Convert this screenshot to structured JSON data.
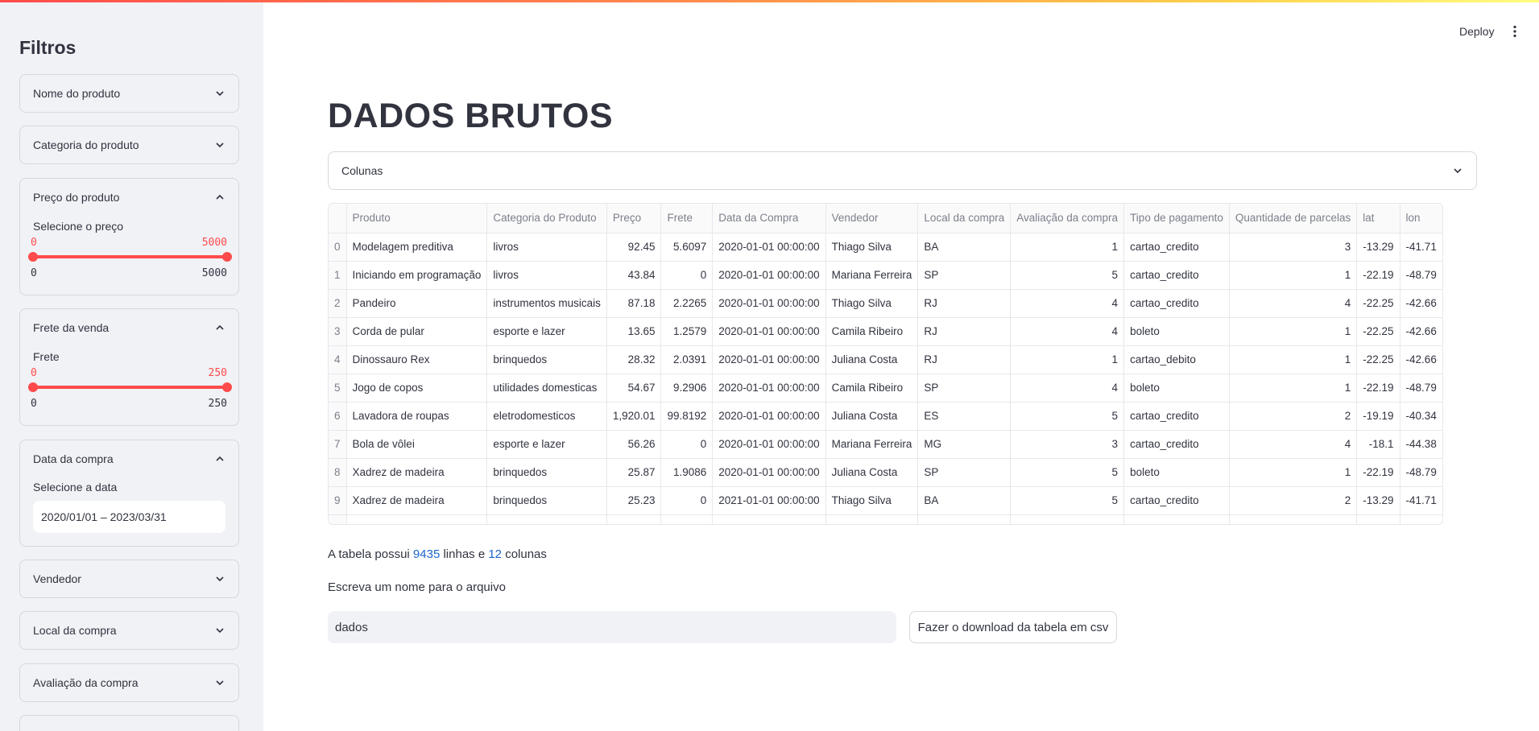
{
  "header": {
    "deploy_label": "Deploy",
    "menu_icon": "kebab-icon"
  },
  "sidebar": {
    "title": "Filtros",
    "nome_produto": {
      "label": "Nome do produto"
    },
    "categoria": {
      "label": "Categoria do produto"
    },
    "preco": {
      "label": "Preço do produto",
      "slider_label": "Selecione o preço",
      "low": "0",
      "high": "5000",
      "min": "0",
      "max": "5000"
    },
    "frete": {
      "label": "Frete da venda",
      "slider_label": "Frete",
      "low": "0",
      "high": "250",
      "min": "0",
      "max": "250"
    },
    "data": {
      "label": "Data da compra",
      "input_label": "Selecione a data",
      "value": "2020/01/01 – 2023/03/31"
    },
    "vendedor": {
      "label": "Vendedor"
    },
    "local": {
      "label": "Local da compra"
    },
    "avaliacao": {
      "label": "Avaliação da compra"
    }
  },
  "main": {
    "title": "DADOS BRUTOS",
    "columns_select": "Colunas",
    "table": {
      "headers": [
        "",
        "Produto",
        "Categoria do Produto",
        "Preço",
        "Frete",
        "Data da Compra",
        "Vendedor",
        "Local da compra",
        "Avaliação da compra",
        "Tipo de pagamento",
        "Quantidade de parcelas",
        "lat",
        "lon"
      ],
      "rows": [
        [
          "0",
          "Modelagem preditiva",
          "livros",
          "92.45",
          "5.6097",
          "2020-01-01 00:00:00",
          "Thiago Silva",
          "BA",
          "1",
          "cartao_credito",
          "3",
          "-13.29",
          "-41.71"
        ],
        [
          "1",
          "Iniciando em programação",
          "livros",
          "43.84",
          "0",
          "2020-01-01 00:00:00",
          "Mariana Ferreira",
          "SP",
          "5",
          "cartao_credito",
          "1",
          "-22.19",
          "-48.79"
        ],
        [
          "2",
          "Pandeiro",
          "instrumentos musicais",
          "87.18",
          "2.2265",
          "2020-01-01 00:00:00",
          "Thiago Silva",
          "RJ",
          "4",
          "cartao_credito",
          "4",
          "-22.25",
          "-42.66"
        ],
        [
          "3",
          "Corda de pular",
          "esporte e lazer",
          "13.65",
          "1.2579",
          "2020-01-01 00:00:00",
          "Camila Ribeiro",
          "RJ",
          "4",
          "boleto",
          "1",
          "-22.25",
          "-42.66"
        ],
        [
          "4",
          "Dinossauro Rex",
          "brinquedos",
          "28.32",
          "2.0391",
          "2020-01-01 00:00:00",
          "Juliana Costa",
          "RJ",
          "1",
          "cartao_debito",
          "1",
          "-22.25",
          "-42.66"
        ],
        [
          "5",
          "Jogo de copos",
          "utilidades domesticas",
          "54.67",
          "9.2906",
          "2020-01-01 00:00:00",
          "Camila Ribeiro",
          "SP",
          "4",
          "boleto",
          "1",
          "-22.19",
          "-48.79"
        ],
        [
          "6",
          "Lavadora de roupas",
          "eletrodomesticos",
          "1,920.01",
          "99.8192",
          "2020-01-01 00:00:00",
          "Juliana Costa",
          "ES",
          "5",
          "cartao_credito",
          "2",
          "-19.19",
          "-40.34"
        ],
        [
          "7",
          "Bola de vôlei",
          "esporte e lazer",
          "56.26",
          "0",
          "2020-01-01 00:00:00",
          "Mariana Ferreira",
          "MG",
          "3",
          "cartao_credito",
          "4",
          "-18.1",
          "-44.38"
        ],
        [
          "8",
          "Xadrez de madeira",
          "brinquedos",
          "25.87",
          "1.9086",
          "2020-01-01 00:00:00",
          "Juliana Costa",
          "SP",
          "5",
          "boleto",
          "1",
          "-22.19",
          "-48.79"
        ],
        [
          "9",
          "Xadrez de madeira",
          "brinquedos",
          "25.23",
          "0",
          "2021-01-01 00:00:00",
          "Thiago Silva",
          "BA",
          "5",
          "cartao_credito",
          "2",
          "-13.29",
          "-41.71"
        ]
      ]
    },
    "info": {
      "prefix": "A tabela possui ",
      "rows": "9435",
      "middle": " linhas e ",
      "cols": "12",
      "suffix": " colunas"
    },
    "file_label": "Escreva um nome para o arquivo",
    "file_value": "dados",
    "download_label": "Fazer o download da tabela em csv"
  },
  "colors": {
    "accent": "#ff4b4b",
    "sidebar_bg": "#f0f2f6",
    "link": "#1c64c8"
  }
}
